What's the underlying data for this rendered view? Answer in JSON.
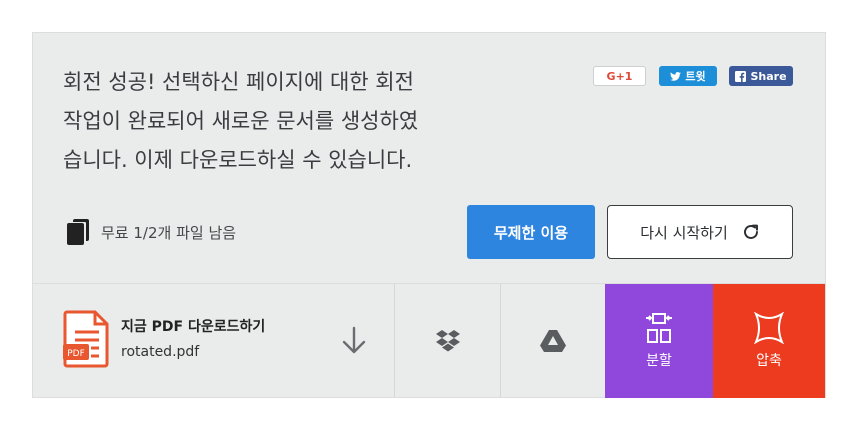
{
  "message": {
    "line1": "회전 성공! 선택하신 페이지에 대한 회전",
    "line2": "작업이 완료되어 새로운 문서를 생성하였",
    "line3": "습니다. 이제 다운로드하실 수 있습니다."
  },
  "social": {
    "gplus_label": "G+1",
    "tweet_label": "트윗",
    "share_label": "Share"
  },
  "quota": {
    "text": "무료 1/2개 파일 남음"
  },
  "buttons": {
    "unlimited": "무제한 이용",
    "restart": "다시 시작하기"
  },
  "download": {
    "title": "지금 PDF 다운로드하기",
    "filename": "rotated.pdf",
    "badge": "PDF"
  },
  "tiles": {
    "split": "분할",
    "compress": "압축"
  },
  "colors": {
    "primary_blue": "#2e85e0",
    "split_purple": "#8f48db",
    "compress_red": "#ec3b1f",
    "pdf_orange": "#e8572f",
    "twitter_blue": "#1d8fd8",
    "facebook_blue": "#3b5998"
  },
  "icons": [
    "document-stack-icon",
    "pdf-file-icon",
    "download-arrow-icon",
    "dropbox-icon",
    "google-drive-icon",
    "split-icon",
    "compress-icon",
    "refresh-icon",
    "twitter-icon",
    "facebook-icon"
  ]
}
